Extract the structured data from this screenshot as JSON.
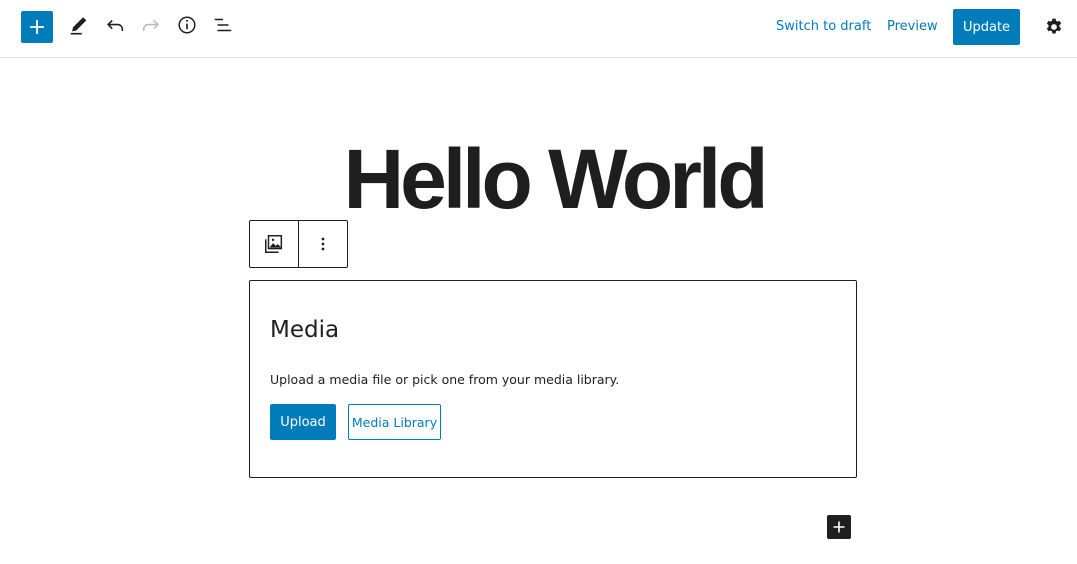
{
  "header": {
    "switch_to_draft_label": "Switch to draft",
    "preview_label": "Preview",
    "update_label": "Update"
  },
  "post": {
    "title": "Hello World"
  },
  "media_block": {
    "title": "Media",
    "instructions": "Upload a media file or pick one from your media library.",
    "upload_label": "Upload",
    "library_label": "Media Library"
  },
  "colors": {
    "accent": "#007cba",
    "text": "#1e1e1e",
    "border": "#e0e0e0"
  },
  "icons": {
    "inserter": "plus-icon",
    "tools": "pencil-icon",
    "undo": "undo-icon",
    "redo": "redo-icon",
    "details": "info-icon",
    "list_view": "list-view-icon",
    "settings": "gear-icon",
    "block_type": "gallery-icon",
    "block_options": "more-vertical-icon",
    "append": "plus-icon"
  }
}
